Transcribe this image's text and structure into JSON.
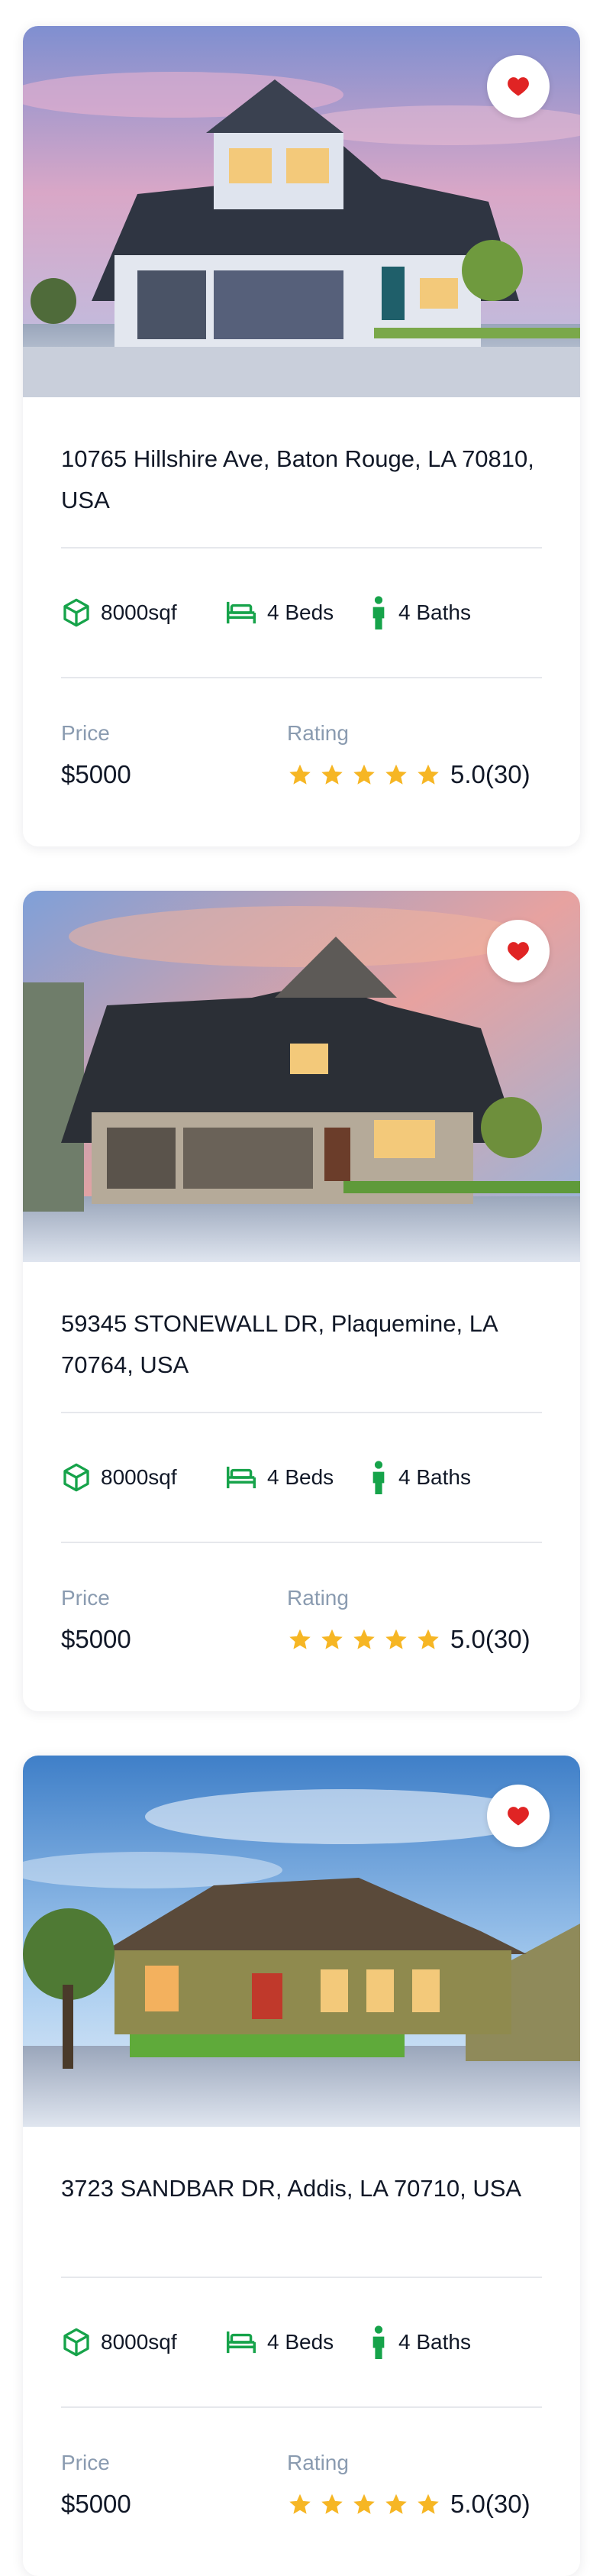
{
  "colors": {
    "accent_green": "#16a34a",
    "star": "#f6b624",
    "heart": "#e02424",
    "label_gray": "#8a9bb0"
  },
  "icons": {
    "favorite": "heart-icon",
    "area": "cube-icon",
    "beds": "bed-icon",
    "baths": "person-icon",
    "rating": "star-icon"
  },
  "listings": [
    {
      "address": "10765 Hillshire Ave, Baton Rouge, LA 70810, USA",
      "area": "8000sqf",
      "beds": "4 Beds",
      "baths": "4 Baths",
      "price_label": "Price",
      "price": "$5000",
      "rating_label": "Rating",
      "rating": "5.0(30)",
      "stars": 5
    },
    {
      "address": "59345 STONEWALL DR, Plaquemine, LA 70764, USA",
      "area": "8000sqf",
      "beds": "4 Beds",
      "baths": "4 Baths",
      "price_label": "Price",
      "price": "$5000",
      "rating_label": "Rating",
      "rating": "5.0(30)",
      "stars": 5
    },
    {
      "address": "3723 SANDBAR DR, Addis, LA 70710, USA",
      "area": "8000sqf",
      "beds": "4 Beds",
      "baths": "4 Baths",
      "price_label": "Price",
      "price": "$5000",
      "rating_label": "Rating",
      "rating": "5.0(30)",
      "stars": 5
    }
  ]
}
